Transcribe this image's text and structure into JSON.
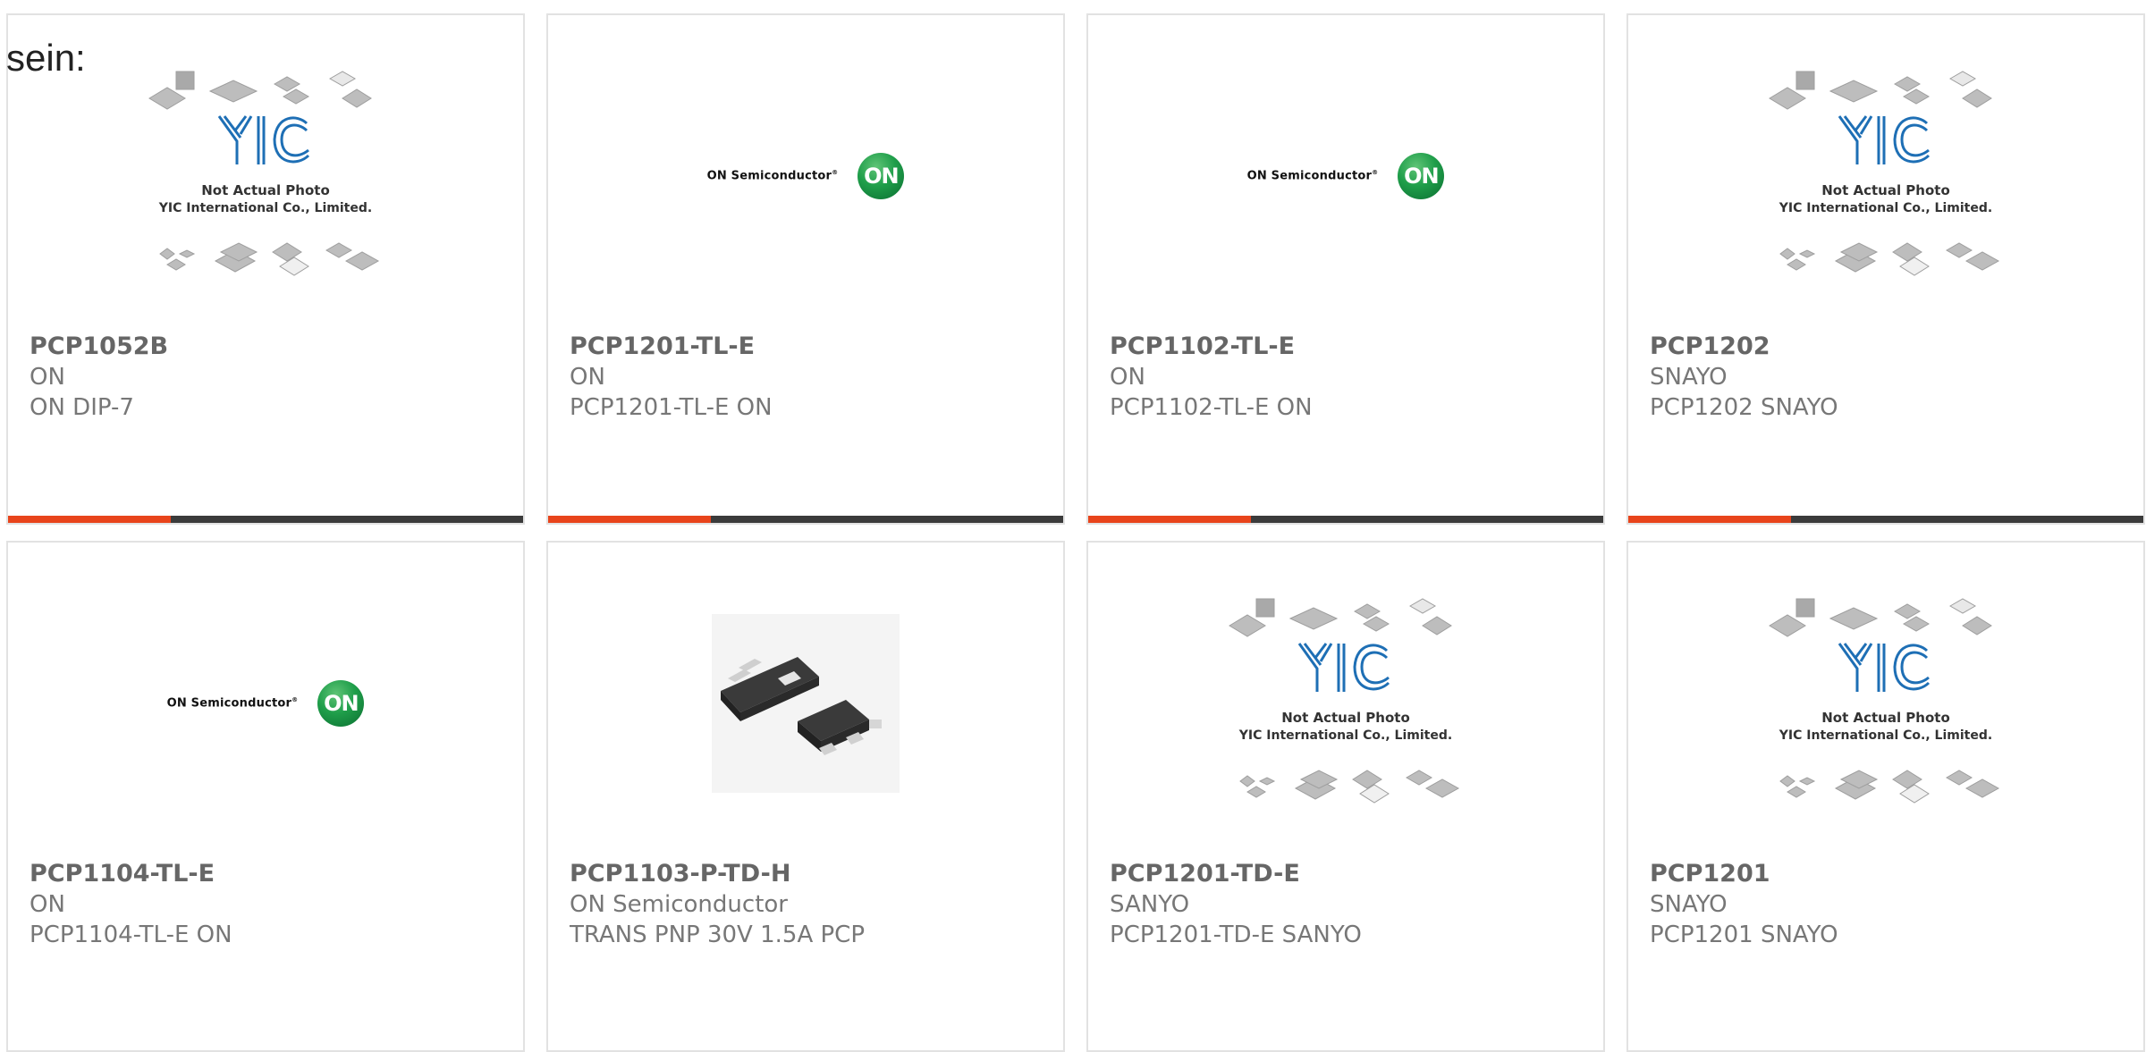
{
  "intro_text": "sein:",
  "placeholder": {
    "line1": "Not Actual Photo",
    "line2": "YIC International Co., Limited."
  },
  "on_logo": {
    "text": "ON Semiconductor",
    "badge": "ON"
  },
  "colors": {
    "accent": "#e8441b",
    "bar": "#3b3b3b",
    "on_green": "#1f9e4a",
    "yic_blue": "#1e6fb5"
  },
  "products": [
    {
      "part": "PCP1052B",
      "brand": "ON",
      "desc": "ON DIP-7",
      "image": "yic-placeholder"
    },
    {
      "part": "PCP1201-TL-E",
      "brand": "ON",
      "desc": "PCP1201-TL-E ON",
      "image": "on-semiconductor-logo"
    },
    {
      "part": "PCP1102-TL-E",
      "brand": "ON",
      "desc": "PCP1102-TL-E ON",
      "image": "on-semiconductor-logo"
    },
    {
      "part": "PCP1202",
      "brand": "SNAYO",
      "desc": "PCP1202 SNAYO",
      "image": "yic-placeholder"
    },
    {
      "part": "PCP1104-TL-E",
      "brand": "ON",
      "desc": "PCP1104-TL-E ON",
      "image": "on-semiconductor-logo"
    },
    {
      "part": "PCP1103-P-TD-H",
      "brand": "ON Semiconductor",
      "desc": "TRANS PNP 30V 1.5A PCP",
      "image": "chip-photo"
    },
    {
      "part": "PCP1201-TD-E",
      "brand": "SANYO",
      "desc": "PCP1201-TD-E SANYO",
      "image": "yic-placeholder"
    },
    {
      "part": "PCP1201",
      "brand": "SNAYO",
      "desc": "PCP1201 SNAYO",
      "image": "yic-placeholder"
    }
  ]
}
